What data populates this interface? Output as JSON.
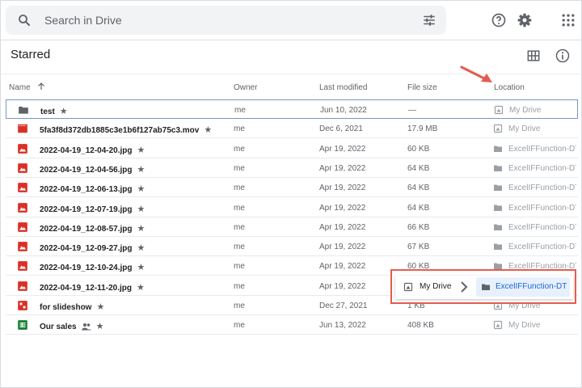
{
  "search": {
    "placeholder": "Search in Drive"
  },
  "page_title": "Starred",
  "columns": {
    "name": "Name",
    "owner": "Owner",
    "modified": "Last modified",
    "size": "File size",
    "location": "Location"
  },
  "rows": [
    {
      "name": "test",
      "owner": "me",
      "modified": "Jun 10, 2022",
      "size": "—",
      "location": "My Drive",
      "type": "folder-icon",
      "loc_icon": "my-drive-icon"
    },
    {
      "name": "5fa3f8d372db1885c3e1b6f127ab75c3.mov",
      "owner": "me",
      "modified": "Dec 6, 2021",
      "size": "17.9 MB",
      "location": "My Drive",
      "type": "video-file-icon",
      "loc_icon": "my-drive-icon"
    },
    {
      "name": "2022-04-19_12-04-20.jpg",
      "owner": "me",
      "modified": "Apr 19, 2022",
      "size": "60 KB",
      "location": "ExcelIFFunction-DT",
      "type": "image-file-icon",
      "loc_icon": "folder-icon"
    },
    {
      "name": "2022-04-19_12-04-56.jpg",
      "owner": "me",
      "modified": "Apr 19, 2022",
      "size": "64 KB",
      "location": "ExcelIFFunction-DT",
      "type": "image-file-icon",
      "loc_icon": "folder-icon"
    },
    {
      "name": "2022-04-19_12-06-13.jpg",
      "owner": "me",
      "modified": "Apr 19, 2022",
      "size": "64 KB",
      "location": "ExcelIFFunction-DT",
      "type": "image-file-icon",
      "loc_icon": "folder-icon"
    },
    {
      "name": "2022-04-19_12-07-19.jpg",
      "owner": "me",
      "modified": "Apr 19, 2022",
      "size": "64 KB",
      "location": "ExcelIFFunction-DT",
      "type": "image-file-icon",
      "loc_icon": "folder-icon"
    },
    {
      "name": "2022-04-19_12-08-57.jpg",
      "owner": "me",
      "modified": "Apr 19, 2022",
      "size": "66 KB",
      "location": "ExcelIFFunction-DT",
      "type": "image-file-icon",
      "loc_icon": "folder-icon"
    },
    {
      "name": "2022-04-19_12-09-27.jpg",
      "owner": "me",
      "modified": "Apr 19, 2022",
      "size": "67 KB",
      "location": "ExcelIFFunction-DT",
      "type": "image-file-icon",
      "loc_icon": "folder-icon"
    },
    {
      "name": "2022-04-19_12-10-24.jpg",
      "owner": "me",
      "modified": "Apr 19, 2022",
      "size": "60 KB",
      "location": "ExcelIFFunction-DT",
      "type": "image-file-icon",
      "loc_icon": "folder-icon"
    },
    {
      "name": "2022-04-19_12-11-20.jpg",
      "owner": "me",
      "modified": "Apr 19, 2022",
      "size": "",
      "location": "",
      "type": "image-file-icon",
      "loc_icon": ""
    },
    {
      "name": "for slideshow",
      "owner": "me",
      "modified": "Dec 27, 2021",
      "size": "1 KB",
      "location": "My Drive",
      "type": "slides-file-icon",
      "loc_icon": "my-drive-icon"
    },
    {
      "name": "Our sales",
      "owner": "me",
      "modified": "Jun 13, 2022",
      "size": "408 KB",
      "location": "My Drive",
      "type": "sheets-file-icon",
      "loc_icon": "my-drive-icon",
      "shared": true
    }
  ],
  "location_popup": {
    "root": "My Drive",
    "folder": "ExcelIFFunction-DT"
  },
  "colors": {
    "accent": "#1967d2",
    "highlight": "#e55c4f",
    "selected_border": "#7894c8"
  }
}
